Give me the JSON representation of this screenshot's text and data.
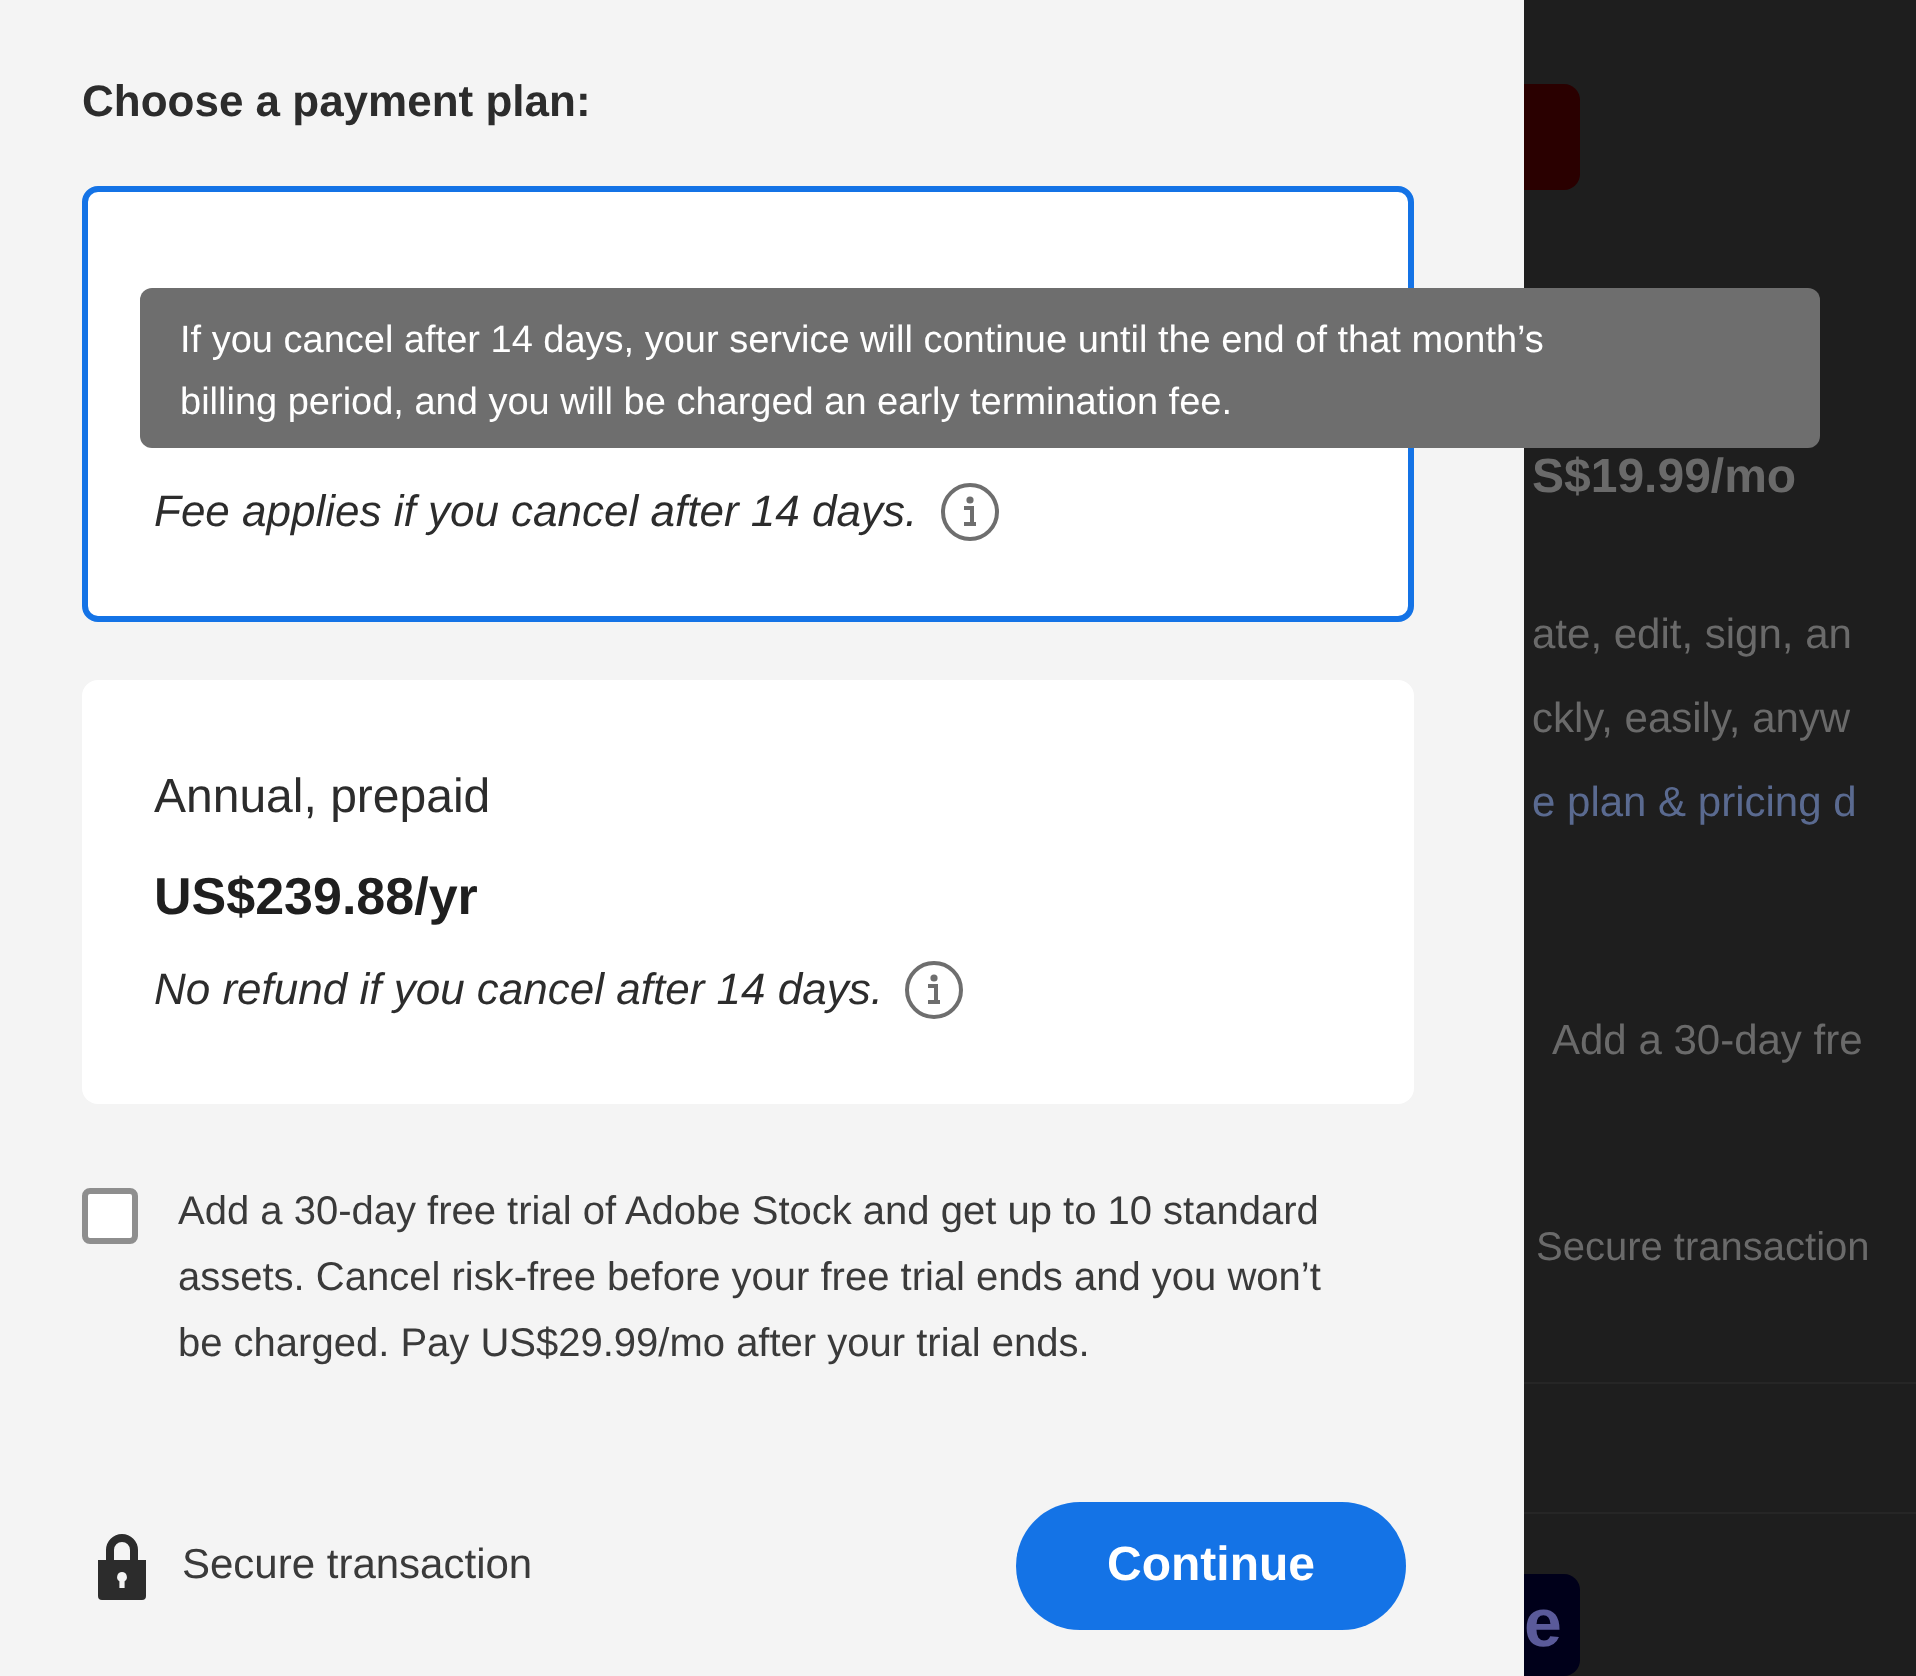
{
  "heading": "Choose a payment plan:",
  "plans": [
    {
      "selected": true,
      "note": "Fee applies if you cancel after 14 days."
    },
    {
      "selected": false,
      "name": "Annual, prepaid",
      "price": "US$239.88/yr",
      "note": "No refund if you cancel after 14 days."
    }
  ],
  "tooltip": {
    "text": "If you cancel after 14 days, your service will continue until the end of that month’s billing period, and you will be charged an early termination fee."
  },
  "stock_offer": {
    "checked": false,
    "text": "Add a 30-day free trial of Adobe Stock and get up to 10 standard assets. Cancel risk-free before your free trial ends and you won’t be charged. Pay US$29.99/mo after your trial ends."
  },
  "footer": {
    "secure_label": "Secure transaction",
    "continue_button": "Continue"
  },
  "background_page": {
    "price": "S$19.99/mo",
    "description_lines": [
      "ate, edit, sign, an",
      "ckly, easily, anyw"
    ],
    "link": "e plan & pricing d",
    "offer": "Add a 30-day fre",
    "secure_label": "Secure transaction",
    "logo_letter": "e"
  }
}
